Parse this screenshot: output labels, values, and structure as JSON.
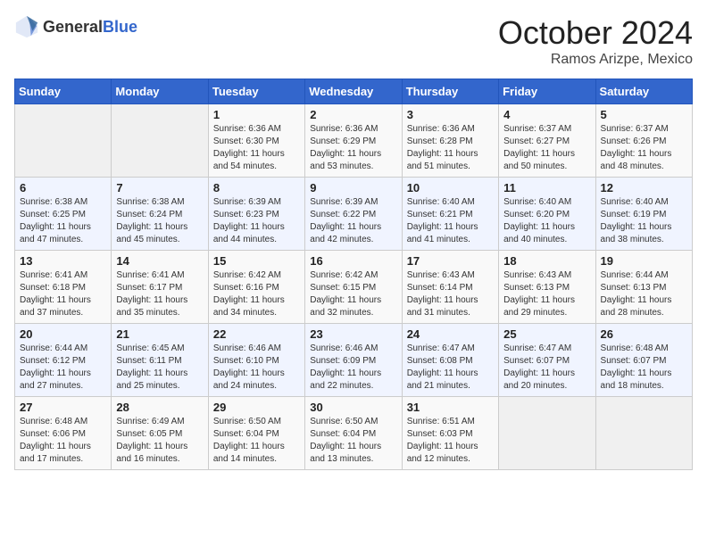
{
  "header": {
    "logo_general": "General",
    "logo_blue": "Blue",
    "month_title": "October 2024",
    "location": "Ramos Arizpe, Mexico"
  },
  "weekdays": [
    "Sunday",
    "Monday",
    "Tuesday",
    "Wednesday",
    "Thursday",
    "Friday",
    "Saturday"
  ],
  "weeks": [
    [
      {
        "day": "",
        "sunrise": "",
        "sunset": "",
        "daylight": ""
      },
      {
        "day": "",
        "sunrise": "",
        "sunset": "",
        "daylight": ""
      },
      {
        "day": "1",
        "sunrise": "Sunrise: 6:36 AM",
        "sunset": "Sunset: 6:30 PM",
        "daylight": "Daylight: 11 hours and 54 minutes."
      },
      {
        "day": "2",
        "sunrise": "Sunrise: 6:36 AM",
        "sunset": "Sunset: 6:29 PM",
        "daylight": "Daylight: 11 hours and 53 minutes."
      },
      {
        "day": "3",
        "sunrise": "Sunrise: 6:36 AM",
        "sunset": "Sunset: 6:28 PM",
        "daylight": "Daylight: 11 hours and 51 minutes."
      },
      {
        "day": "4",
        "sunrise": "Sunrise: 6:37 AM",
        "sunset": "Sunset: 6:27 PM",
        "daylight": "Daylight: 11 hours and 50 minutes."
      },
      {
        "day": "5",
        "sunrise": "Sunrise: 6:37 AM",
        "sunset": "Sunset: 6:26 PM",
        "daylight": "Daylight: 11 hours and 48 minutes."
      }
    ],
    [
      {
        "day": "6",
        "sunrise": "Sunrise: 6:38 AM",
        "sunset": "Sunset: 6:25 PM",
        "daylight": "Daylight: 11 hours and 47 minutes."
      },
      {
        "day": "7",
        "sunrise": "Sunrise: 6:38 AM",
        "sunset": "Sunset: 6:24 PM",
        "daylight": "Daylight: 11 hours and 45 minutes."
      },
      {
        "day": "8",
        "sunrise": "Sunrise: 6:39 AM",
        "sunset": "Sunset: 6:23 PM",
        "daylight": "Daylight: 11 hours and 44 minutes."
      },
      {
        "day": "9",
        "sunrise": "Sunrise: 6:39 AM",
        "sunset": "Sunset: 6:22 PM",
        "daylight": "Daylight: 11 hours and 42 minutes."
      },
      {
        "day": "10",
        "sunrise": "Sunrise: 6:40 AM",
        "sunset": "Sunset: 6:21 PM",
        "daylight": "Daylight: 11 hours and 41 minutes."
      },
      {
        "day": "11",
        "sunrise": "Sunrise: 6:40 AM",
        "sunset": "Sunset: 6:20 PM",
        "daylight": "Daylight: 11 hours and 40 minutes."
      },
      {
        "day": "12",
        "sunrise": "Sunrise: 6:40 AM",
        "sunset": "Sunset: 6:19 PM",
        "daylight": "Daylight: 11 hours and 38 minutes."
      }
    ],
    [
      {
        "day": "13",
        "sunrise": "Sunrise: 6:41 AM",
        "sunset": "Sunset: 6:18 PM",
        "daylight": "Daylight: 11 hours and 37 minutes."
      },
      {
        "day": "14",
        "sunrise": "Sunrise: 6:41 AM",
        "sunset": "Sunset: 6:17 PM",
        "daylight": "Daylight: 11 hours and 35 minutes."
      },
      {
        "day": "15",
        "sunrise": "Sunrise: 6:42 AM",
        "sunset": "Sunset: 6:16 PM",
        "daylight": "Daylight: 11 hours and 34 minutes."
      },
      {
        "day": "16",
        "sunrise": "Sunrise: 6:42 AM",
        "sunset": "Sunset: 6:15 PM",
        "daylight": "Daylight: 11 hours and 32 minutes."
      },
      {
        "day": "17",
        "sunrise": "Sunrise: 6:43 AM",
        "sunset": "Sunset: 6:14 PM",
        "daylight": "Daylight: 11 hours and 31 minutes."
      },
      {
        "day": "18",
        "sunrise": "Sunrise: 6:43 AM",
        "sunset": "Sunset: 6:13 PM",
        "daylight": "Daylight: 11 hours and 29 minutes."
      },
      {
        "day": "19",
        "sunrise": "Sunrise: 6:44 AM",
        "sunset": "Sunset: 6:13 PM",
        "daylight": "Daylight: 11 hours and 28 minutes."
      }
    ],
    [
      {
        "day": "20",
        "sunrise": "Sunrise: 6:44 AM",
        "sunset": "Sunset: 6:12 PM",
        "daylight": "Daylight: 11 hours and 27 minutes."
      },
      {
        "day": "21",
        "sunrise": "Sunrise: 6:45 AM",
        "sunset": "Sunset: 6:11 PM",
        "daylight": "Daylight: 11 hours and 25 minutes."
      },
      {
        "day": "22",
        "sunrise": "Sunrise: 6:46 AM",
        "sunset": "Sunset: 6:10 PM",
        "daylight": "Daylight: 11 hours and 24 minutes."
      },
      {
        "day": "23",
        "sunrise": "Sunrise: 6:46 AM",
        "sunset": "Sunset: 6:09 PM",
        "daylight": "Daylight: 11 hours and 22 minutes."
      },
      {
        "day": "24",
        "sunrise": "Sunrise: 6:47 AM",
        "sunset": "Sunset: 6:08 PM",
        "daylight": "Daylight: 11 hours and 21 minutes."
      },
      {
        "day": "25",
        "sunrise": "Sunrise: 6:47 AM",
        "sunset": "Sunset: 6:07 PM",
        "daylight": "Daylight: 11 hours and 20 minutes."
      },
      {
        "day": "26",
        "sunrise": "Sunrise: 6:48 AM",
        "sunset": "Sunset: 6:07 PM",
        "daylight": "Daylight: 11 hours and 18 minutes."
      }
    ],
    [
      {
        "day": "27",
        "sunrise": "Sunrise: 6:48 AM",
        "sunset": "Sunset: 6:06 PM",
        "daylight": "Daylight: 11 hours and 17 minutes."
      },
      {
        "day": "28",
        "sunrise": "Sunrise: 6:49 AM",
        "sunset": "Sunset: 6:05 PM",
        "daylight": "Daylight: 11 hours and 16 minutes."
      },
      {
        "day": "29",
        "sunrise": "Sunrise: 6:50 AM",
        "sunset": "Sunset: 6:04 PM",
        "daylight": "Daylight: 11 hours and 14 minutes."
      },
      {
        "day": "30",
        "sunrise": "Sunrise: 6:50 AM",
        "sunset": "Sunset: 6:04 PM",
        "daylight": "Daylight: 11 hours and 13 minutes."
      },
      {
        "day": "31",
        "sunrise": "Sunrise: 6:51 AM",
        "sunset": "Sunset: 6:03 PM",
        "daylight": "Daylight: 11 hours and 12 minutes."
      },
      {
        "day": "",
        "sunrise": "",
        "sunset": "",
        "daylight": ""
      },
      {
        "day": "",
        "sunrise": "",
        "sunset": "",
        "daylight": ""
      }
    ]
  ]
}
